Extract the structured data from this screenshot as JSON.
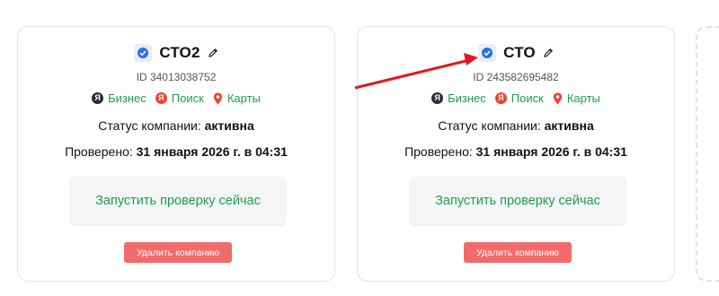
{
  "companies": [
    {
      "name": "СТО2",
      "id_label": "ID 34013038752",
      "links": [
        "Бизнес",
        "Поиск",
        "Карты"
      ],
      "status_prefix": "Статус компании:",
      "status_value": "активна",
      "checked_prefix": "Проверено:",
      "checked_value": "31 января 2026 г. в 04:31",
      "run_button": "Запустить проверку сейчас",
      "delete_button": "Удалить компанию"
    },
    {
      "name": "СТО",
      "id_label": "ID 243582695482",
      "links": [
        "Бизнес",
        "Поиск",
        "Карты"
      ],
      "status_prefix": "Статус компании:",
      "status_value": "активна",
      "checked_prefix": "Проверено:",
      "checked_value": "31 января 2026 г. в 04:31",
      "run_button": "Запустить проверку сейчас",
      "delete_button": "Удалить компанию"
    }
  ],
  "icons": {
    "verified": "verified-check-icon",
    "edit": "pencil-icon",
    "business": "yandex-business-icon",
    "search": "yandex-search-icon",
    "maps": "yandex-maps-pin-icon"
  },
  "colors": {
    "link_green": "#1e9e4c",
    "delete_red": "#f26b6b",
    "verified_blue": "#2f6fe0",
    "annotation_arrow": "#e0191e"
  }
}
